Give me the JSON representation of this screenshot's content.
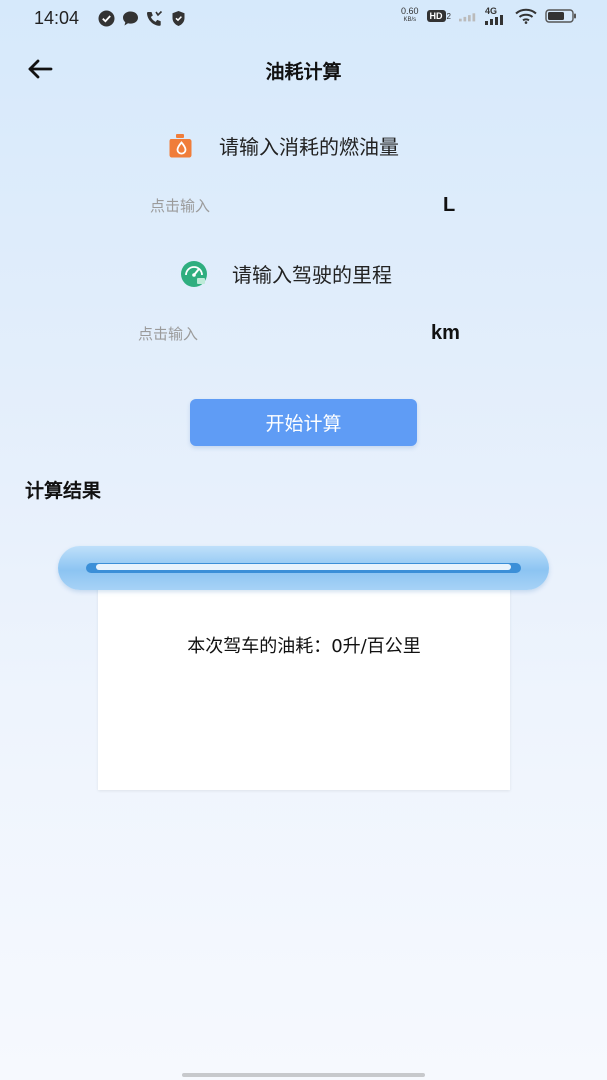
{
  "status_bar": {
    "time": "14:04",
    "net_speed_value": "0.60",
    "net_speed_unit": "KB/s",
    "hd_label": "HD",
    "hd_sub": "2",
    "network_type": "4G"
  },
  "header": {
    "title": "油耗计算"
  },
  "fuel_input": {
    "label": "请输入消耗的燃油量",
    "placeholder": "点击输入",
    "value": "",
    "unit": "L"
  },
  "distance_input": {
    "label": "请输入驾驶的里程",
    "placeholder": "点击输入",
    "value": "",
    "unit": "km"
  },
  "calculate_button": {
    "label": "开始计算"
  },
  "result": {
    "section_title": "计算结果",
    "text": "本次驾车的油耗：0升/百公里"
  },
  "colors": {
    "button": "#5f9cf5",
    "fuel_icon": "#f07d3a",
    "distance_icon": "#2fae7f",
    "scroll": "#8cc4f2"
  }
}
